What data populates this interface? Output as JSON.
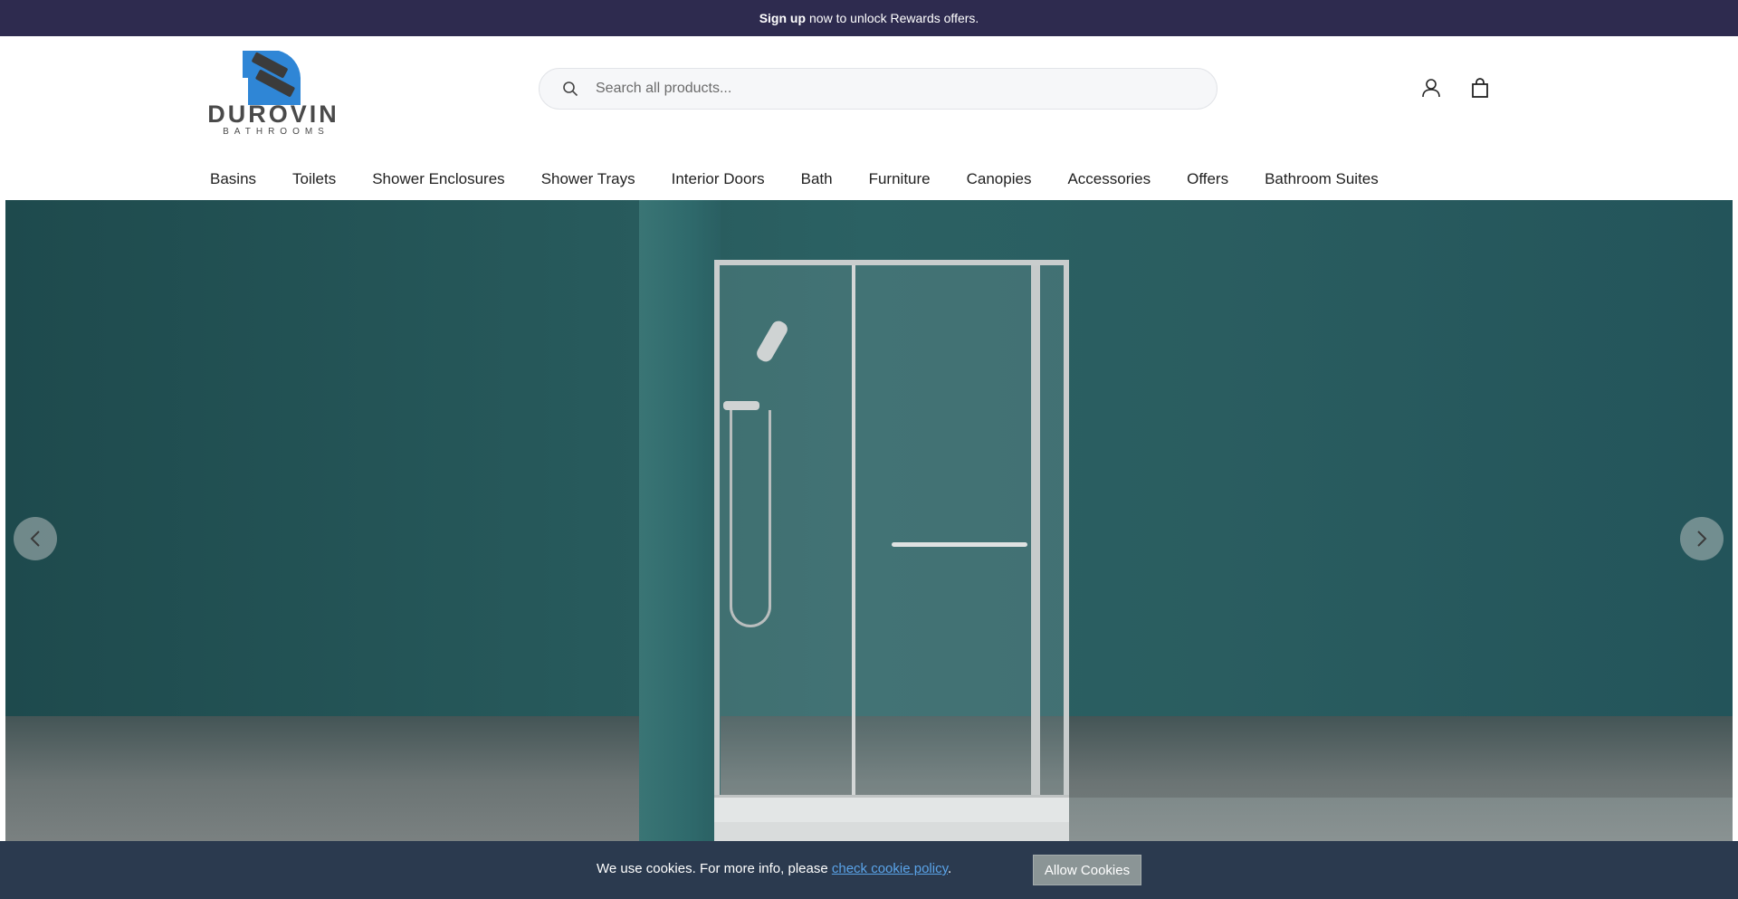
{
  "announcement": {
    "bold": "Sign up",
    "rest": "now to unlock Rewards offers."
  },
  "logo": {
    "wordmark": "DUROVIN",
    "sub": "BATHROOMS",
    "brand_color": "#2f86d6"
  },
  "search": {
    "placeholder": "Search all products..."
  },
  "nav": {
    "items": [
      "Basins",
      "Toilets",
      "Shower Enclosures",
      "Shower Trays",
      "Interior Doors",
      "Bath",
      "Furniture",
      "Canopies",
      "Accessories",
      "Offers",
      "Bathroom Suites"
    ]
  },
  "cookie": {
    "text": "We use cookies. For more info, please",
    "link": "check cookie policy",
    "end": ".",
    "button": "Allow Cookies"
  },
  "colors": {
    "announcement_bg": "#2e2b4f",
    "cookie_bg": "#2b3a4f",
    "hero_wall": "#2a5d60"
  }
}
